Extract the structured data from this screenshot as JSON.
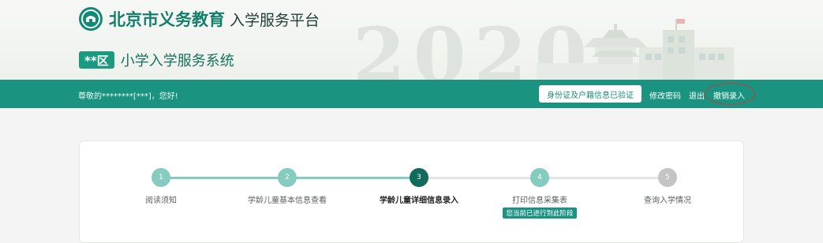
{
  "header": {
    "logo_main": "北京市义务教育",
    "logo_sub": "入学服务平台",
    "district_badge": "**区",
    "system_title": "小学入学服务系统",
    "background_year": "2020"
  },
  "nav": {
    "greeting": "尊敬的********[***]，您好!",
    "verified_badge": "身份证及户籍信息已验证",
    "change_password": "修改密码",
    "logout": "退出",
    "cancel_entry": "撤销录入"
  },
  "progress": {
    "steps": [
      {
        "number": "1",
        "label": "阅读须知",
        "state": "done"
      },
      {
        "number": "2",
        "label": "学龄儿童基本信息查看",
        "state": "done"
      },
      {
        "number": "3",
        "label": "学龄儿童详细信息录入",
        "state": "current"
      },
      {
        "number": "4",
        "label": "打印信息采集表",
        "state": "next",
        "tag": "您当前已进行到此阶段"
      },
      {
        "number": "5",
        "label": "查询入学情况",
        "state": "pending"
      }
    ]
  },
  "colors": {
    "brand": "#1a9480",
    "done": "#86cbc0",
    "current": "#126a5b",
    "pending": "#c4c4c4",
    "annotation": "#c83b3b"
  },
  "icons": {
    "logo": "education-emblem-icon"
  }
}
